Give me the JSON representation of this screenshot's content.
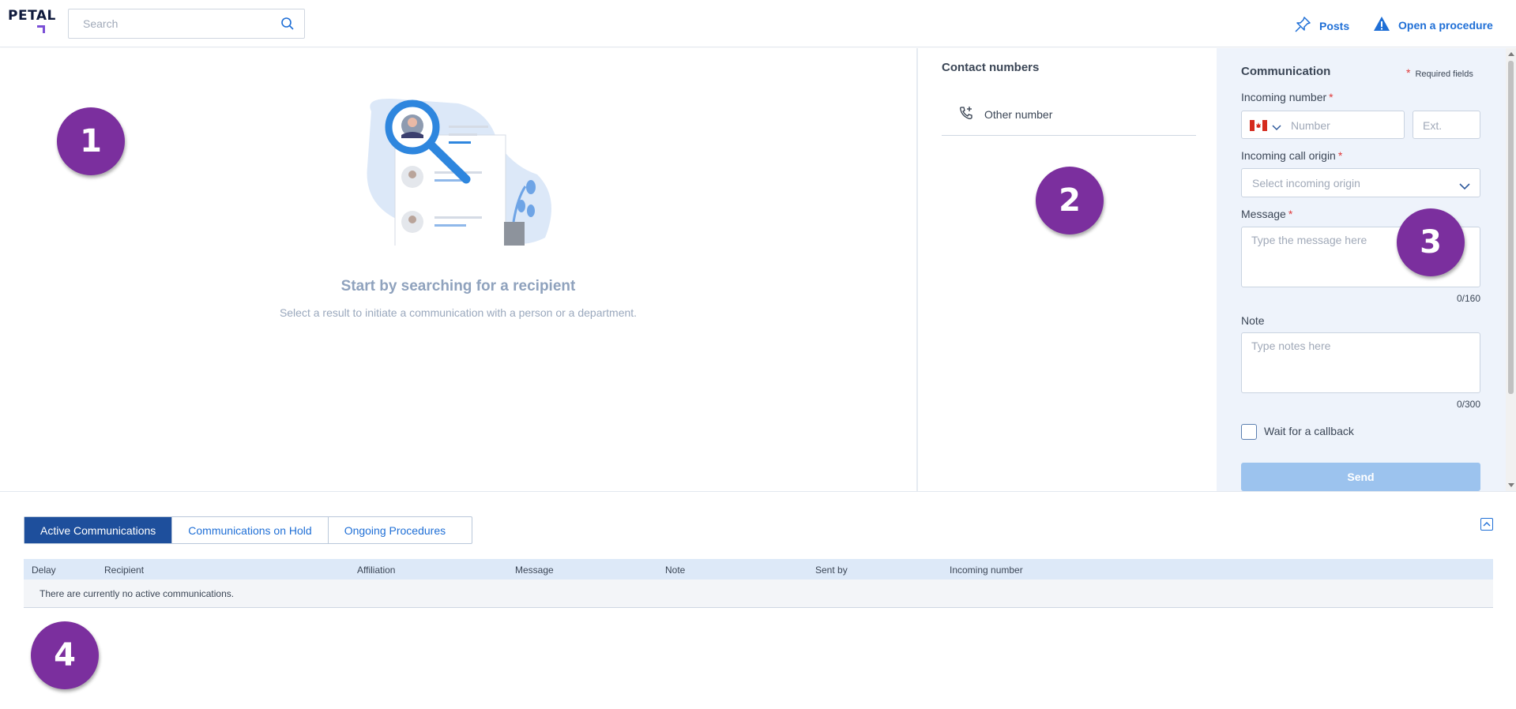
{
  "header": {
    "logo_text": "PETAL",
    "search_placeholder": "Search",
    "posts_label": "Posts",
    "procedure_label": "Open a procedure"
  },
  "badges": [
    "1",
    "2",
    "3",
    "4"
  ],
  "empty_state": {
    "title": "Start by searching for a recipient",
    "subtitle": "Select a result to initiate a communication with a person or a department."
  },
  "contacts": {
    "title": "Contact numbers",
    "other_number": "Other number"
  },
  "communication_form": {
    "title": "Communication",
    "required_star": "*",
    "required_note": "Required fields",
    "incoming_number_label": "Incoming number",
    "number_placeholder": "Number",
    "ext_placeholder": "Ext.",
    "call_origin_label": "Incoming call origin",
    "call_origin_placeholder": "Select incoming origin",
    "message_label": "Message",
    "message_placeholder": "Type the message here",
    "message_counter": "0/160",
    "note_label": "Note",
    "note_placeholder": "Type notes here",
    "note_counter": "0/300",
    "callback_label": "Wait for a callback",
    "send_label": "Send"
  },
  "bottom": {
    "tabs": [
      "Active Communications",
      "Communications on Hold",
      "Ongoing Procedures"
    ],
    "columns": [
      "Delay",
      "Recipient",
      "Affiliation",
      "Message",
      "Note",
      "Sent by",
      "Incoming number"
    ],
    "empty_message": "There are currently no active communications."
  },
  "colors": {
    "accent": "#1f6fd6",
    "badge": "#7b2f9e",
    "active_tab": "#1e4f9c",
    "required": "#e03a3a"
  }
}
